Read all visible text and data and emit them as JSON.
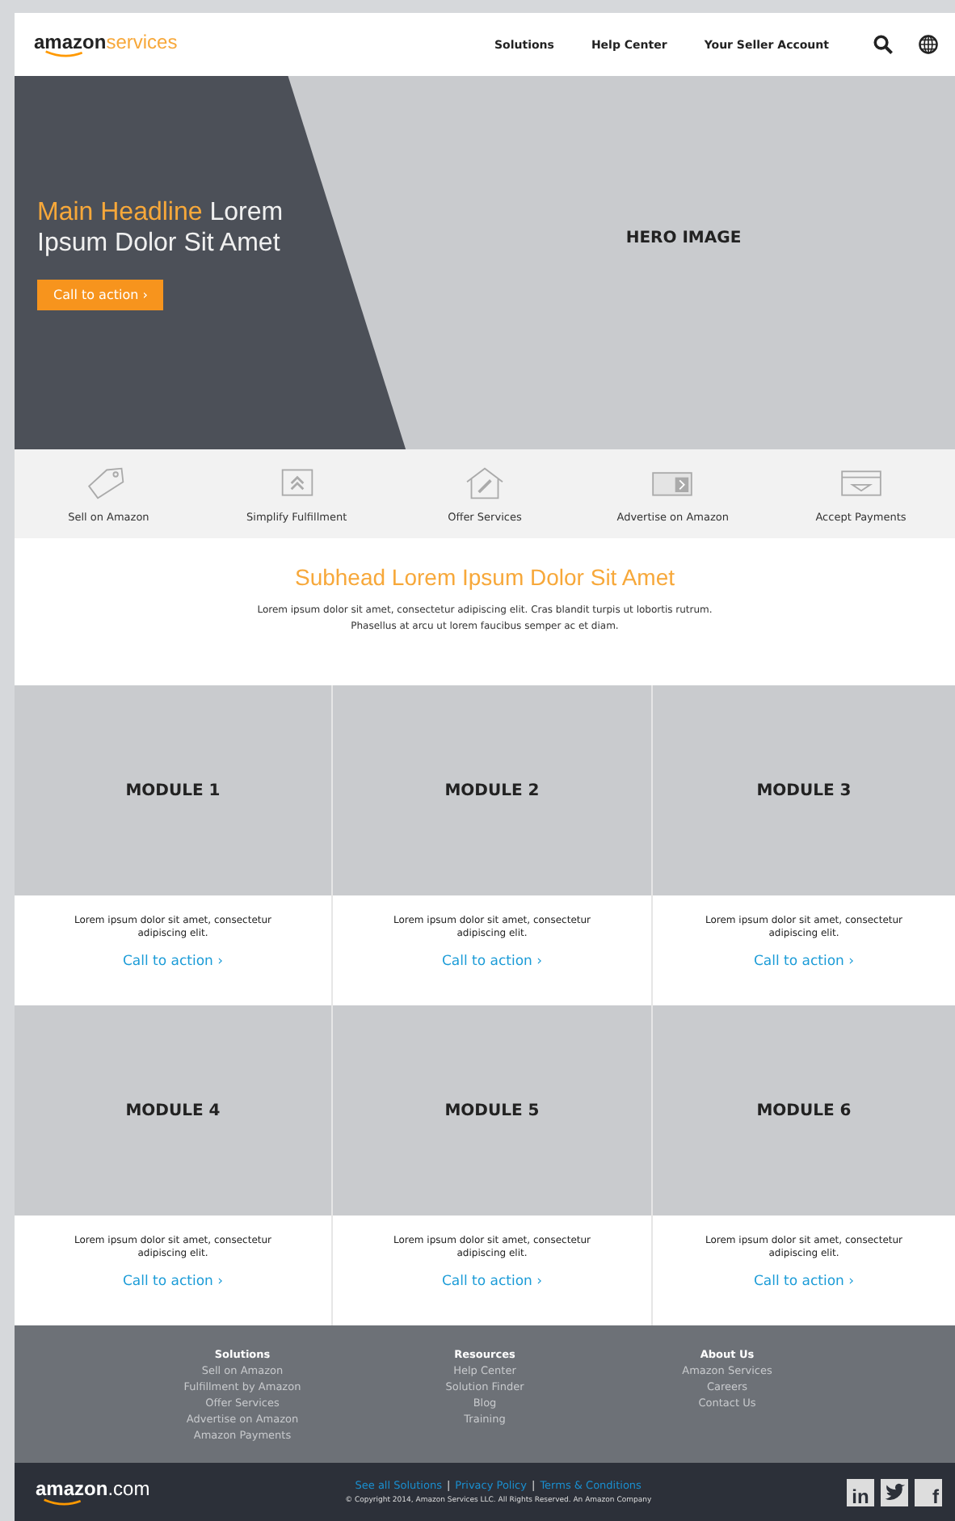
{
  "header": {
    "logo": {
      "brand": "amazon",
      "suffix": "services"
    },
    "nav": [
      {
        "label": "Solutions"
      },
      {
        "label": "Help Center"
      },
      {
        "label": "Your Seller Account"
      }
    ]
  },
  "hero": {
    "headline_accent": "Main Headline",
    "headline_rest": " Lorem Ipsum Dolor Sit Amet",
    "cta": "Call to action  ›",
    "image_label": "HERO IMAGE"
  },
  "features": [
    {
      "kind": "tag",
      "label": "Sell on Amazon"
    },
    {
      "kind": "box",
      "label": "Simplify Fulfillment"
    },
    {
      "kind": "house",
      "label": "Offer Services"
    },
    {
      "kind": "ad",
      "label": "Advertise on Amazon"
    },
    {
      "kind": "card",
      "label": "Accept Payments"
    }
  ],
  "intro": {
    "subhead": "Subhead Lorem Ipsum Dolor Sit Amet",
    "body": "Lorem ipsum dolor sit amet, consectetur adipiscing elit. Cras blandit turpis ut lobortis rutrum. Phasellus at arcu ut lorem faucibus semper ac et diam."
  },
  "modules": [
    {
      "title": "MODULE 1",
      "text": "Lorem ipsum dolor sit amet, consectetur adipiscing elit.",
      "cta": "Call to action  ›"
    },
    {
      "title": "MODULE 2",
      "text": "Lorem ipsum dolor sit amet, consectetur adipiscing elit.",
      "cta": "Call to action  ›"
    },
    {
      "title": "MODULE 3",
      "text": "Lorem ipsum dolor sit amet, consectetur adipiscing elit.",
      "cta": "Call to action  ›"
    },
    {
      "title": "MODULE 4",
      "text": "Lorem ipsum dolor sit amet, consectetur adipiscing elit.",
      "cta": "Call to action  ›"
    },
    {
      "title": "MODULE 5",
      "text": "Lorem ipsum dolor sit amet, consectetur adipiscing elit.",
      "cta": "Call to action  ›"
    },
    {
      "title": "MODULE 6",
      "text": "Lorem ipsum dolor sit amet, consectetur adipiscing elit.",
      "cta": "Call to action  ›"
    }
  ],
  "footer": {
    "columns": [
      {
        "heading": "Solutions",
        "links": [
          "Sell on Amazon",
          "Fulfillment by Amazon",
          "Offer Services",
          "Advertise on Amazon",
          "Amazon Payments"
        ]
      },
      {
        "heading": "Resources",
        "links": [
          "Help Center",
          "Solution Finder",
          "Blog",
          "Training"
        ]
      },
      {
        "heading": "About Us",
        "links": [
          "Amazon Services",
          "Careers",
          "Contact Us"
        ]
      }
    ],
    "logo": {
      "brand": "amazon",
      "suffix": ".com"
    },
    "legal": [
      {
        "kind": "link",
        "text": "See all Solutions"
      },
      {
        "kind": "separator",
        "text": "|"
      },
      {
        "kind": "link",
        "text": "Privacy Policy"
      },
      {
        "kind": "separator",
        "text": "|"
      },
      {
        "kind": "link",
        "text": "Terms & Conditions"
      }
    ],
    "copyright": "© Copyright 2014, Amazon Services LLC. All Rights Reserved. An Amazon Company",
    "social": [
      {
        "kind": "linkedin",
        "label": "in"
      },
      {
        "kind": "twitter"
      },
      {
        "kind": "facebook",
        "label": "f"
      }
    ]
  }
}
